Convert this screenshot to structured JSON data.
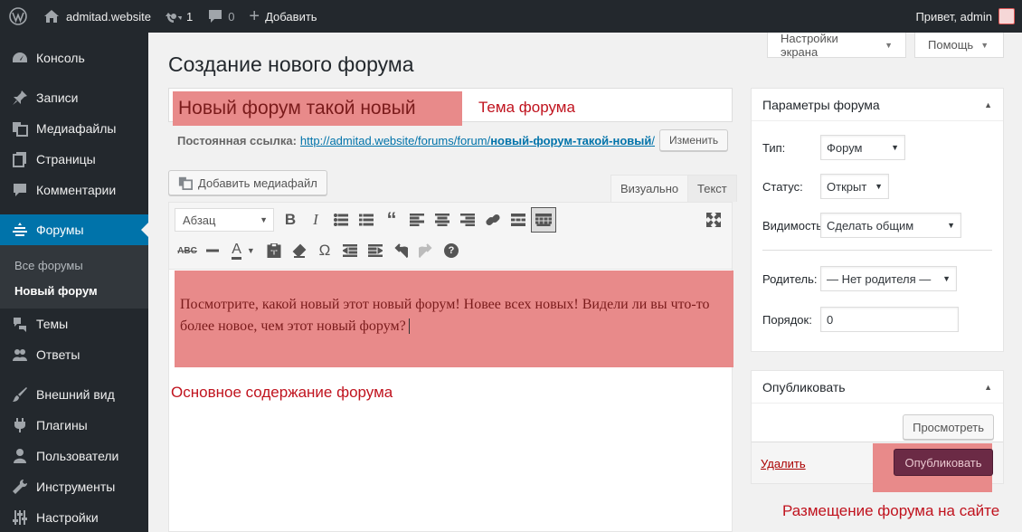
{
  "adminbar": {
    "site_name": "admitad.website",
    "updates_count": "1",
    "comments_count": "0",
    "add_new_label": "Добавить",
    "greeting": "Привет, admin"
  },
  "sidebar": {
    "items": [
      {
        "label": "Консоль",
        "icon": "dashboard-icon"
      },
      {
        "label": "Записи",
        "icon": "pin-icon"
      },
      {
        "label": "Медиафайлы",
        "icon": "media-icon"
      },
      {
        "label": "Страницы",
        "icon": "pages-icon"
      },
      {
        "label": "Комментарии",
        "icon": "comments-icon"
      },
      {
        "label": "Форумы",
        "icon": "forums-icon"
      },
      {
        "label": "Темы",
        "icon": "topics-icon"
      },
      {
        "label": "Ответы",
        "icon": "replies-icon"
      },
      {
        "label": "Внешний вид",
        "icon": "brush-icon"
      },
      {
        "label": "Плагины",
        "icon": "plugin-icon"
      },
      {
        "label": "Пользователи",
        "icon": "users-icon"
      },
      {
        "label": "Инструменты",
        "icon": "tools-icon"
      },
      {
        "label": "Настройки",
        "icon": "settings-icon"
      }
    ],
    "submenu": [
      "Все форумы",
      "Новый форум"
    ]
  },
  "screen_options_label": "Настройки экрана",
  "help_label": "Помощь",
  "page_title": "Создание нового форума",
  "title_field": {
    "value": "Новый форум такой новый"
  },
  "annotations": {
    "topic": "Тема форума",
    "content": "Основное содержание форума",
    "publish": "Размещение форума на сайте"
  },
  "permalink": {
    "label": "Постоянная ссылка:",
    "url_base": "http://admitad.website/forums/forum/",
    "slug": "новый-форум-такой-новый",
    "trail": "/",
    "edit_label": "Изменить"
  },
  "editor": {
    "add_media_label": "Добавить медиафайл",
    "tab_visual": "Визуально",
    "tab_text": "Текст",
    "format_value": "Абзац",
    "content": "Посмотрите, какой новый этот новый форум! Новее всех новых! Видели ли вы что-то более новое, чем этот новый форум?"
  },
  "params_box": {
    "title": "Параметры форума",
    "type_label": "Тип:",
    "type_value": "Форум",
    "status_label": "Статус:",
    "status_value": "Открыт",
    "visibility_label": "Видимость:",
    "visibility_value": "Сделать общим",
    "parent_label": "Родитель:",
    "parent_value": "— Нет родителя —",
    "order_label": "Порядок:",
    "order_value": "0"
  },
  "publish_box": {
    "title": "Опубликовать",
    "preview_label": "Просмотреть",
    "delete_label": "Удалить",
    "publish_label": "Опубликовать"
  }
}
